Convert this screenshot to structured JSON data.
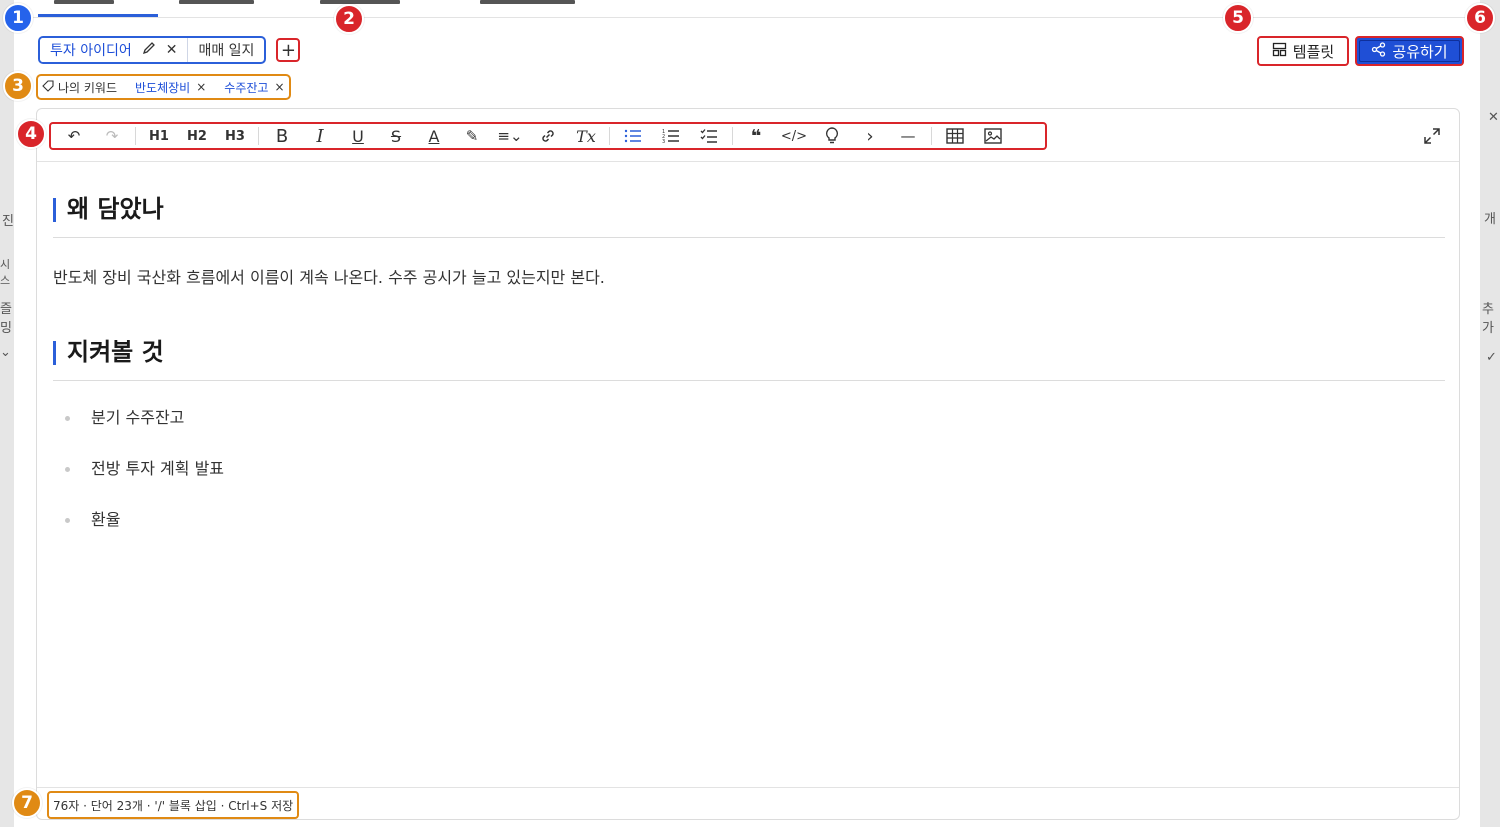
{
  "background": {
    "left_glyphs": [
      "진",
      "시스",
      "즐밍",
      "⌄"
    ],
    "right_glyphs": [
      "✕",
      "개",
      "추가",
      "✓"
    ]
  },
  "doc_tabs": {
    "tabs": [
      {
        "label": "투자 아이디어",
        "active": true,
        "edit_icon": "pencil-icon",
        "close_icon": "close-icon"
      },
      {
        "label": "매매 일지",
        "active": false
      }
    ],
    "add_label": "+"
  },
  "keywords": {
    "label": "나의 키워드",
    "label_icon": "tag-icon",
    "chips": [
      {
        "label": "반도체장비",
        "close": "×"
      },
      {
        "label": "수주잔고",
        "close": "×"
      }
    ]
  },
  "header_buttons": {
    "template_label": "템플릿",
    "template_icon": "template-icon",
    "share_label": "공유하기",
    "share_icon": "share-icon"
  },
  "toolbar": {
    "undo": "↶",
    "redo": "↷",
    "h1": "H1",
    "h2": "H2",
    "h3": "H3",
    "bold": "B",
    "italic": "I",
    "underline": "U",
    "strike": "S",
    "text_color": "A",
    "highlight": "✎",
    "align": "≡⌄",
    "link": "🔗",
    "clear_format": "Tx",
    "bullet_list": "☰",
    "ordered_list": "⒈",
    "task_list": "☑",
    "quote": "❝",
    "code": "</>",
    "callout": "💡",
    "toggle": "›",
    "divider": "—",
    "table": "▦",
    "image": "🖼",
    "expand": "⤢"
  },
  "document": {
    "heading1": "왜 담았나",
    "paragraph1": "반도체 장비 국산화 흐름에서 이름이 계속 나온다. 수주 공시가 늘고 있는지만 본다.",
    "heading2": "지켜볼 것",
    "bullets": [
      "분기 수주잔고",
      "전방 투자 계획 발표",
      "환율"
    ]
  },
  "status_bar": {
    "text": "76자 · 단어 23개 · '/' 블록 삽입 · Ctrl+S 저장"
  },
  "markers": [
    "1",
    "2",
    "3",
    "4",
    "5",
    "6",
    "7"
  ],
  "colors": {
    "accent": "#2b5fd9",
    "share_button": "#1f4fd6",
    "marker_blue": "#2563eb",
    "marker_red": "#d9252a",
    "marker_orange": "#e08a14"
  }
}
